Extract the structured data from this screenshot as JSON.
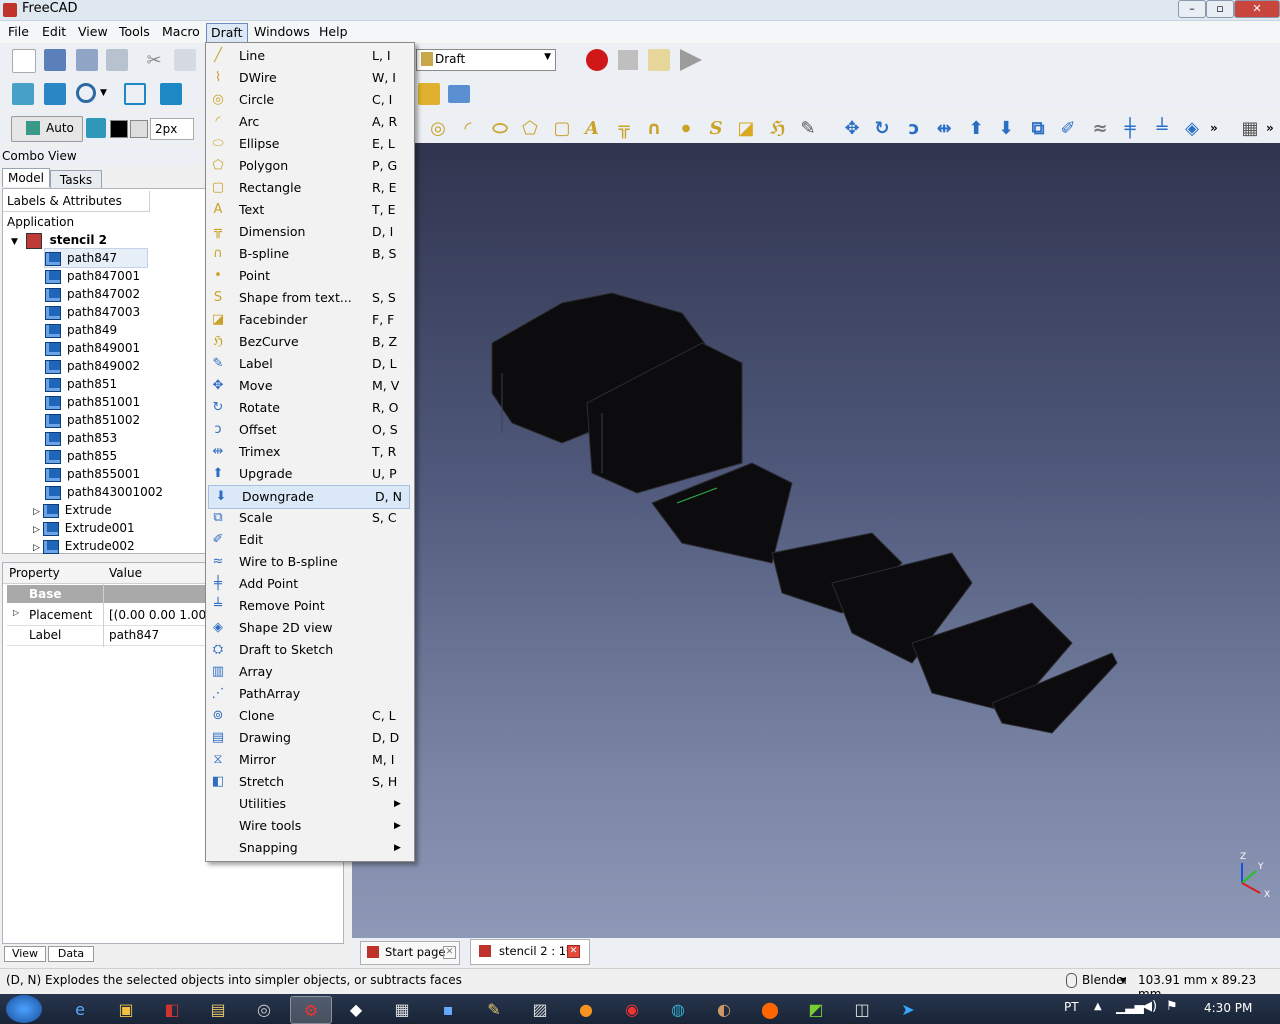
{
  "window": {
    "title": "FreeCAD"
  },
  "menubar": [
    "File",
    "Edit",
    "View",
    "Tools",
    "Macro",
    "Draft",
    "Windows",
    "Help"
  ],
  "workbench": "Draft",
  "draft_toolbar": {
    "auto_label": "Auto",
    "linewidth": "2px"
  },
  "combo": {
    "title": "Combo View",
    "tabs": [
      "Model",
      "Tasks"
    ],
    "tree_header": "Labels & Attributes",
    "root_label": "Application",
    "document": "stencil 2",
    "items": [
      "path847",
      "path847001",
      "path847002",
      "path847003",
      "path849",
      "path849001",
      "path849002",
      "path851",
      "path851001",
      "path851002",
      "path853",
      "path855",
      "path855001",
      "path843001002",
      "Extrude",
      "Extrude001",
      "Extrude002"
    ],
    "prop_headers": [
      "Property",
      "Value"
    ],
    "prop_group": "Base",
    "props": [
      {
        "name": "Placement",
        "value": "[(0.00 0.00 1.00); 0..."
      },
      {
        "name": "Label",
        "value": "path847"
      }
    ],
    "bottom_tabs": [
      "View",
      "Data"
    ]
  },
  "draft_menu": [
    {
      "label": "Line",
      "shortcut": "L, I",
      "icon": "line-icon"
    },
    {
      "label": "DWire",
      "shortcut": "W, I",
      "icon": "wire-icon"
    },
    {
      "label": "Circle",
      "shortcut": "C, I",
      "icon": "circle-icon"
    },
    {
      "label": "Arc",
      "shortcut": "A, R",
      "icon": "arc-icon"
    },
    {
      "label": "Ellipse",
      "shortcut": "E, L",
      "icon": "ellipse-icon"
    },
    {
      "label": "Polygon",
      "shortcut": "P, G",
      "icon": "polygon-icon"
    },
    {
      "label": "Rectangle",
      "shortcut": "R, E",
      "icon": "rectangle-icon"
    },
    {
      "label": "Text",
      "shortcut": "T, E",
      "icon": "text-icon"
    },
    {
      "label": "Dimension",
      "shortcut": "D, I",
      "icon": "dimension-icon"
    },
    {
      "label": "B-spline",
      "shortcut": "B, S",
      "icon": "bspline-icon"
    },
    {
      "label": "Point",
      "shortcut": "",
      "icon": "point-icon"
    },
    {
      "label": "Shape from text...",
      "shortcut": "S, S",
      "icon": "shapestring-icon"
    },
    {
      "label": "Facebinder",
      "shortcut": "F, F",
      "icon": "facebinder-icon"
    },
    {
      "label": "BezCurve",
      "shortcut": "B, Z",
      "icon": "bezcurve-icon"
    },
    {
      "label": "Label",
      "shortcut": "D, L",
      "icon": "label-icon"
    },
    {
      "label": "Move",
      "shortcut": "M, V",
      "icon": "move-icon"
    },
    {
      "label": "Rotate",
      "shortcut": "R, O",
      "icon": "rotate-icon"
    },
    {
      "label": "Offset",
      "shortcut": "O, S",
      "icon": "offset-icon"
    },
    {
      "label": "Trimex",
      "shortcut": "T, R",
      "icon": "trimex-icon"
    },
    {
      "label": "Upgrade",
      "shortcut": "U, P",
      "icon": "upgrade-icon"
    },
    {
      "label": "Downgrade",
      "shortcut": "D, N",
      "icon": "downgrade-icon"
    },
    {
      "label": "Scale",
      "shortcut": "S, C",
      "icon": "scale-icon"
    },
    {
      "label": "Edit",
      "shortcut": "",
      "icon": "edit-icon"
    },
    {
      "label": "Wire to B-spline",
      "shortcut": "",
      "icon": "wire-to-bspline-icon"
    },
    {
      "label": "Add Point",
      "shortcut": "",
      "icon": "add-point-icon"
    },
    {
      "label": "Remove Point",
      "shortcut": "",
      "icon": "remove-point-icon"
    },
    {
      "label": "Shape 2D view",
      "shortcut": "",
      "icon": "shape2dview-icon"
    },
    {
      "label": "Draft to Sketch",
      "shortcut": "",
      "icon": "draft-to-sketch-icon"
    },
    {
      "label": "Array",
      "shortcut": "",
      "icon": "array-icon"
    },
    {
      "label": "PathArray",
      "shortcut": "",
      "icon": "patharray-icon"
    },
    {
      "label": "Clone",
      "shortcut": "C, L",
      "icon": "clone-icon"
    },
    {
      "label": "Drawing",
      "shortcut": "D, D",
      "icon": "drawing-icon"
    },
    {
      "label": "Mirror",
      "shortcut": "M, I",
      "icon": "mirror-icon"
    },
    {
      "label": "Stretch",
      "shortcut": "S, H",
      "icon": "stretch-icon"
    },
    {
      "label": "Utilities",
      "shortcut": "",
      "icon": "",
      "submenu": true
    },
    {
      "label": "Wire tools",
      "shortcut": "",
      "icon": "",
      "submenu": true
    },
    {
      "label": "Snapping",
      "shortcut": "",
      "icon": "",
      "submenu": true
    }
  ],
  "doc_tabs": [
    {
      "label": "Start page"
    },
    {
      "label": "stencil 2 : 1*"
    }
  ],
  "axis": [
    "Z",
    "Y",
    "X"
  ],
  "statusbar": {
    "message": "(D, N) Explodes the selected objects into simpler objects, or subtracts faces",
    "nav_style": "Blender",
    "dimensions": "103.91 mm x 89.23 mm"
  },
  "taskbar": {
    "lang": "PT",
    "time": "4:30 PM"
  },
  "colors": {
    "highlight": "#dbe8f7",
    "viewport_top": "#30354f",
    "viewport_bottom": "#8e98b7"
  }
}
